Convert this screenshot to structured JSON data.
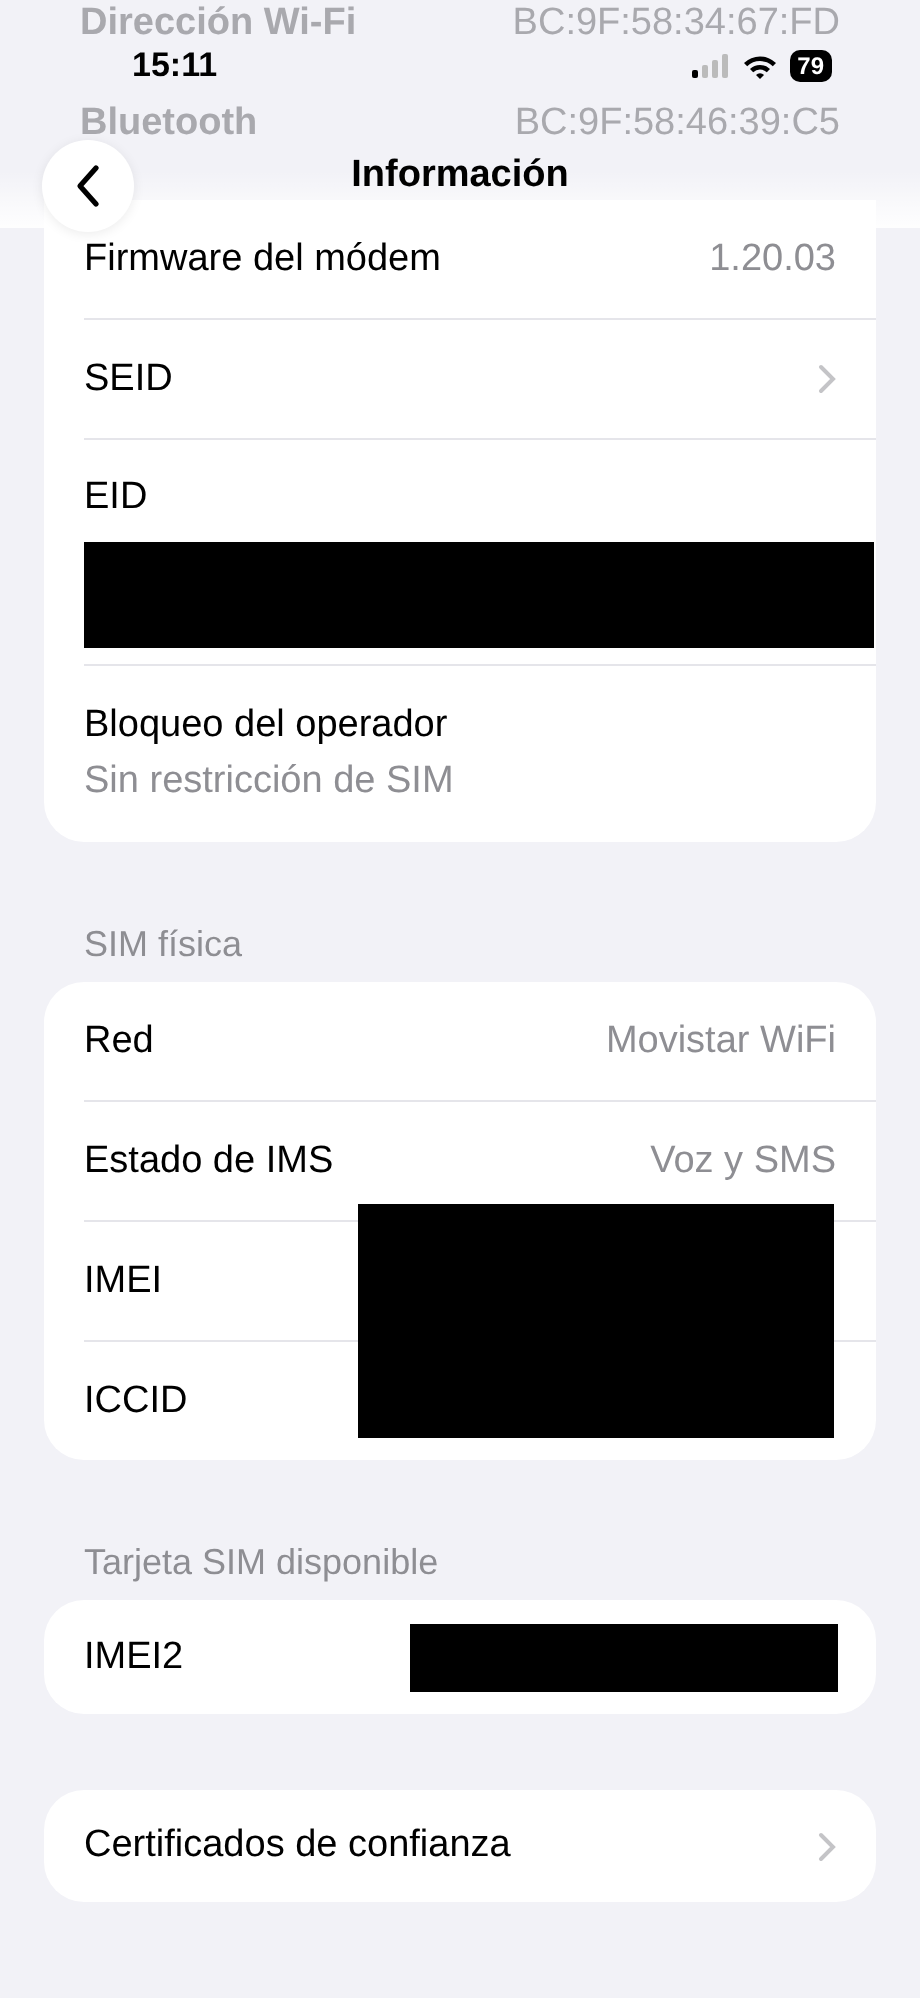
{
  "status_bar": {
    "time": "15:11",
    "battery": "79"
  },
  "background_rows": [
    {
      "label": "Dirección Wi-Fi",
      "value": "BC:9F:58:34:67:FD"
    },
    {
      "label": "Bluetooth",
      "value": "BC:9F:58:46:39:C5"
    }
  ],
  "nav": {
    "title": "Información"
  },
  "sections": [
    {
      "rows": [
        {
          "kind": "value",
          "label": "Firmware del módem",
          "value": "1.20.03"
        },
        {
          "kind": "link",
          "label": "SEID"
        },
        {
          "kind": "redacted",
          "label": "EID"
        },
        {
          "kind": "subtitle",
          "label": "Bloqueo del operador",
          "value": "Sin restricción de SIM"
        }
      ]
    },
    {
      "header": "SIM física",
      "rows": [
        {
          "kind": "value",
          "label": "Red",
          "value": "Movistar WiFi"
        },
        {
          "kind": "value",
          "label": "Estado de IMS",
          "value": "Voz y SMS"
        },
        {
          "kind": "hidden",
          "label": "IMEI"
        },
        {
          "kind": "hidden",
          "label": "ICCID"
        }
      ]
    },
    {
      "header": "Tarjeta SIM disponible",
      "rows": [
        {
          "kind": "inline-redacted",
          "label": "IMEI2"
        }
      ]
    },
    {
      "rows": [
        {
          "kind": "link",
          "label": "Certificados de confianza"
        }
      ]
    }
  ]
}
